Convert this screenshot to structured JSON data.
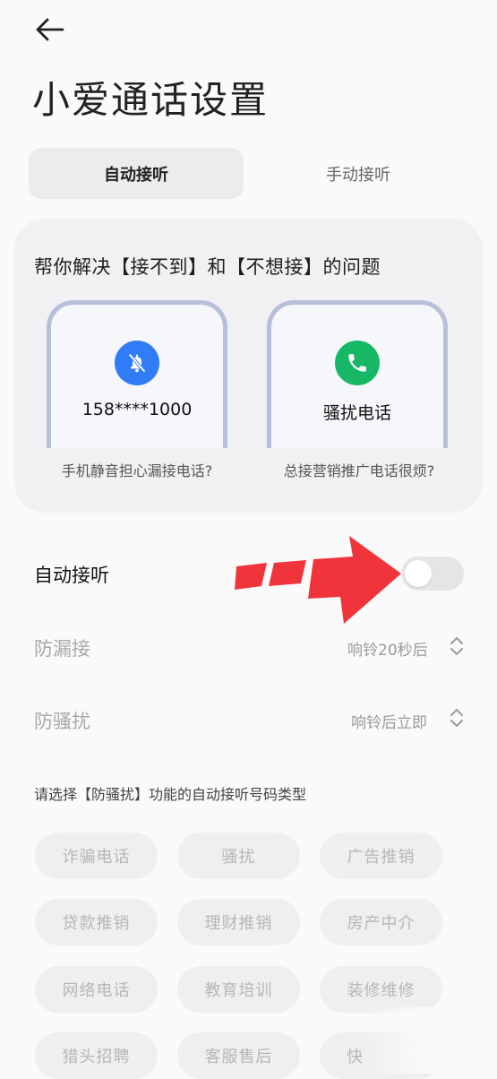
{
  "header": {
    "title": "小爱通话设置"
  },
  "tabs": [
    {
      "label": "自动接听",
      "active": true
    },
    {
      "label": "手动接听",
      "active": false
    }
  ],
  "feature_card": {
    "heading": "帮你解决【接不到】和【不想接】的问题",
    "items": [
      {
        "icon": "bell-muted-icon",
        "phone_text": "158****1000",
        "caption": "手机静音担心漏接电话?"
      },
      {
        "icon": "phone-icon",
        "phone_text": "骚扰电话",
        "caption": "总接营销推广电话很烦?"
      }
    ]
  },
  "settings": {
    "auto_answer": {
      "label": "自动接听",
      "enabled": false
    },
    "missed_call_protect": {
      "label": "防漏接",
      "value": "响铃20秒后"
    },
    "harassment_protect": {
      "label": "防骚扰",
      "value": "响铃后立即"
    }
  },
  "number_types": {
    "hint": "请选择【防骚扰】功能的自动接听号码类型",
    "tags": [
      "诈骗电话",
      "骚扰",
      "广告推销",
      "贷款推销",
      "理财推销",
      "房产中介",
      "网络电话",
      "教育培训",
      "装修维修",
      "猎头招聘",
      "客服售后",
      "快"
    ]
  },
  "colors": {
    "toggle_off": "#e5e5e5",
    "arrow_red": "#f0343c",
    "icon_blue": "#2f7cf6",
    "icon_green": "#17b865"
  }
}
